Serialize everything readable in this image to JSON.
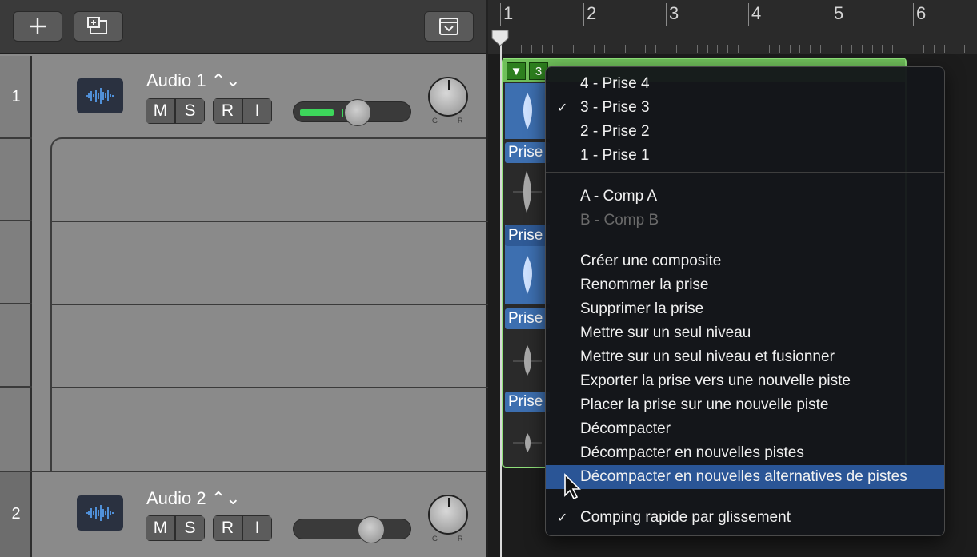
{
  "toolbar": {
    "add_track": "+",
    "new_track_dup": "duplicate",
    "show_hide": "show"
  },
  "ruler": {
    "bars": [
      "1",
      "2",
      "3",
      "4",
      "5",
      "6"
    ]
  },
  "tracks": [
    {
      "number": "1",
      "name": "Audio 1 ⌃⌄",
      "mute": "M",
      "solo": "S",
      "record": "R",
      "input": "I",
      "volume_level": 0.55,
      "pan_left": "G",
      "pan_right": "R"
    },
    {
      "number": "2",
      "name": "Audio 2 ⌃⌄",
      "mute": "M",
      "solo": "S",
      "record": "R",
      "input": "I",
      "volume_level": 0.7,
      "pan_left": "G",
      "pan_right": "R"
    }
  ],
  "take_folder": {
    "toggle": "▼",
    "take_number": "3",
    "takes": [
      {
        "label": "Prise",
        "active": true
      },
      {
        "label": "Prise",
        "active": false
      },
      {
        "label": "Prise",
        "active": true
      },
      {
        "label": "Prise",
        "active": false
      },
      {
        "label": "Prise",
        "active": false
      }
    ]
  },
  "menu": {
    "takes": [
      {
        "label": "4 - Prise 4",
        "checked": false,
        "disabled": false
      },
      {
        "label": "3 - Prise 3",
        "checked": true,
        "disabled": false
      },
      {
        "label": "2 - Prise 2",
        "checked": false,
        "disabled": false
      },
      {
        "label": "1 - Prise 1",
        "checked": false,
        "disabled": false
      }
    ],
    "comps": [
      {
        "label": "A - Comp A",
        "checked": false,
        "disabled": false
      },
      {
        "label": "B - Comp B",
        "checked": false,
        "disabled": true
      }
    ],
    "actions": [
      {
        "label": "Créer une composite",
        "highlight": false
      },
      {
        "label": "Renommer la prise",
        "highlight": false
      },
      {
        "label": "Supprimer la prise",
        "highlight": false
      },
      {
        "label": "Mettre sur un seul niveau",
        "highlight": false
      },
      {
        "label": "Mettre sur un seul niveau et fusionner",
        "highlight": false
      },
      {
        "label": "Exporter la prise vers une nouvelle piste",
        "highlight": false
      },
      {
        "label": "Placer la prise sur une nouvelle piste",
        "highlight": false
      },
      {
        "label": "Décompacter",
        "highlight": false
      },
      {
        "label": "Décompacter en nouvelles pistes",
        "highlight": false
      },
      {
        "label": "Décompacter en nouvelles alternatives de pistes",
        "highlight": true
      }
    ],
    "option": {
      "label": "Comping rapide par glissement",
      "checked": true
    },
    "check_glyph": "✓"
  },
  "colors": {
    "accent_green": "#6fbf5a",
    "highlight_blue": "#2a5596",
    "region_blue": "#3d6fb0",
    "meter_green": "#3dd65b"
  }
}
